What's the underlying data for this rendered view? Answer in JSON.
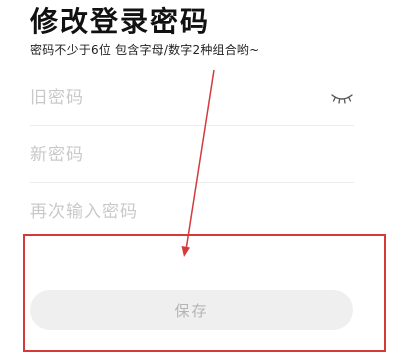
{
  "header": {
    "title": "修改登录密码",
    "hint": "密码不少于6位 包含字母/数字2种组合哟~"
  },
  "form": {
    "old_password_placeholder": "旧密码",
    "new_password_placeholder": "新密码",
    "confirm_password_placeholder": "再次输入密码",
    "old_password_value": "",
    "new_password_value": "",
    "confirm_password_value": ""
  },
  "actions": {
    "save_label": "保存"
  },
  "icons": {
    "visibility_toggle": "eye-closed-icon"
  },
  "colors": {
    "annotation": "#d43a3a",
    "button_bg": "#efefef",
    "button_text": "#b5b5b5",
    "placeholder": "#c9c9c9"
  }
}
